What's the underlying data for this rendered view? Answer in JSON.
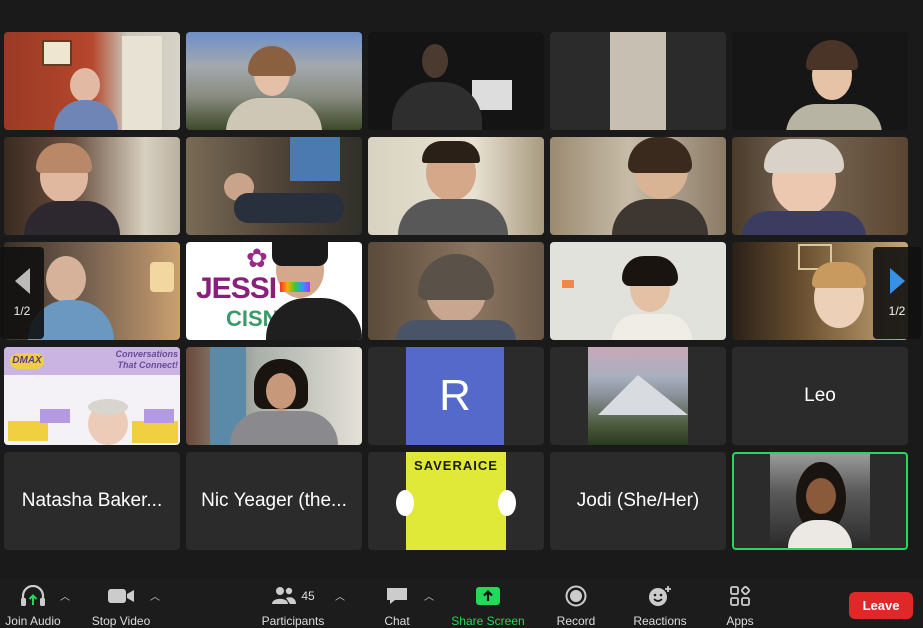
{
  "pagination": {
    "left": "1/2",
    "right": "1/2"
  },
  "tiles": {
    "jessica_sign": "JESSI",
    "jessica_sign2": "CISN",
    "dmax_logo": "DMAX",
    "dmax_text": "Conversations That Connect!",
    "r_avatar": "R",
    "leo": "Leo",
    "natasha": "Natasha Baker...",
    "nic": "Nic Yeager (the...",
    "saveraice": "SAVERAICE",
    "jodi": "Jodi (She/Her)"
  },
  "toolbar": {
    "join_audio": "Join Audio",
    "stop_video": "Stop Video",
    "participants": "Participants",
    "participant_count": "45",
    "chat": "Chat",
    "share_screen": "Share Screen",
    "record": "Record",
    "reactions": "Reactions",
    "apps": "Apps",
    "leave": "Leave"
  },
  "colors": {
    "active_speaker": "#23d959",
    "share_green": "#23d959",
    "leave_red": "#e02828",
    "avatar_blue": "#5469c9"
  }
}
